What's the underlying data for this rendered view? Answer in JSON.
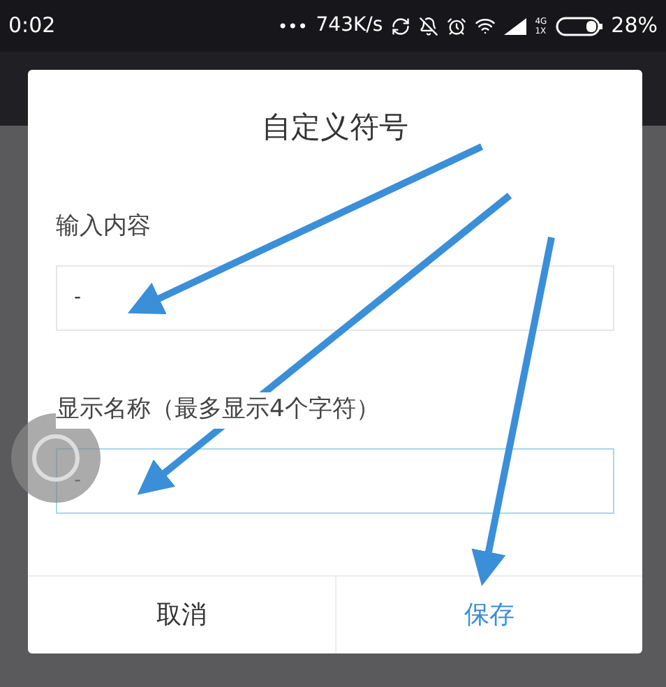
{
  "status_bar": {
    "time": "0:02",
    "more": "•••",
    "speed": "743K/s",
    "network_label": "4G\n1X",
    "battery": "28%"
  },
  "dialog": {
    "title": "自定义符号",
    "fields": [
      {
        "label": "输入内容",
        "value": "-",
        "focused": false
      },
      {
        "label": "显示名称（最多显示4个字符）",
        "value": "-",
        "focused": true
      }
    ],
    "buttons": [
      {
        "label": "取消",
        "primary": false
      },
      {
        "label": "保存",
        "primary": true
      }
    ]
  }
}
